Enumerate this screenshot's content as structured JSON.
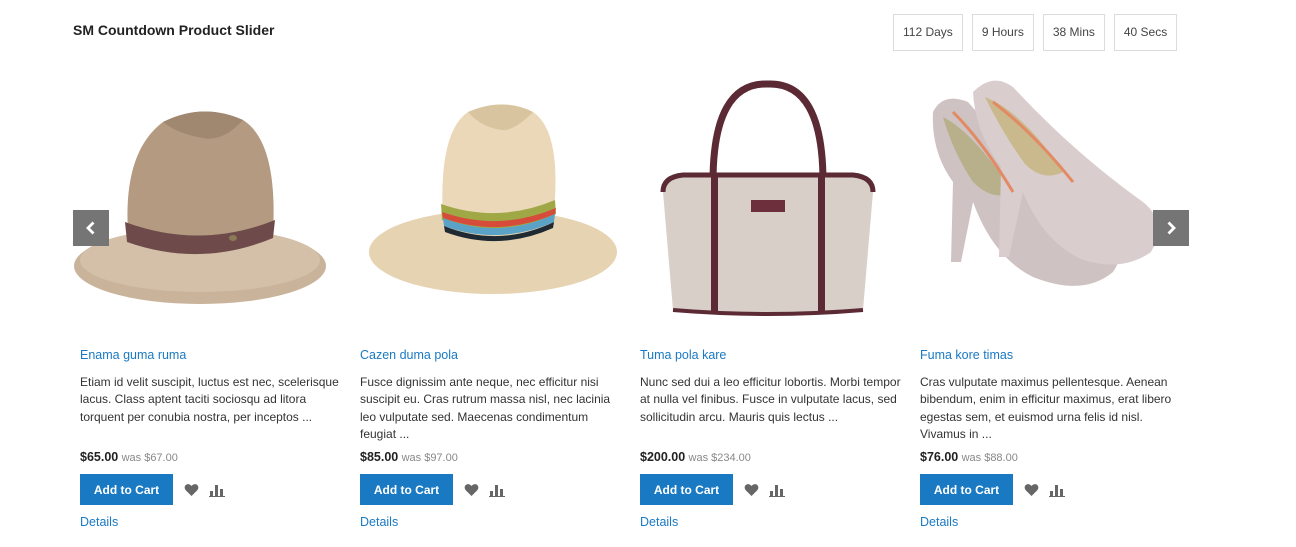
{
  "slider": {
    "title": "SM Countdown Product Slider",
    "countdown": [
      "112 Days",
      "9 Hours",
      "38 Mins",
      "40 Secs"
    ]
  },
  "products": [
    {
      "name": "Enama guma ruma",
      "description": "Etiam id velit suscipit, luctus est nec, scelerisque lacus. Class aptent taciti sociosqu ad litora torquent per conubia nostra, per inceptos ...",
      "price": "$65.00",
      "was": "was $67.00",
      "cart_label": "Add to Cart",
      "details_label": "Details"
    },
    {
      "name": "Cazen duma pola",
      "description": " Fusce dignissim ante neque, nec efficitur nisi suscipit eu. Cras rutrum massa nisl, nec lacinia leo vulputate sed. Maecenas condimentum feugiat ...",
      "price": "$85.00",
      "was": "was $97.00",
      "cart_label": "Add to Cart",
      "details_label": "Details"
    },
    {
      "name": "Tuma pola kare",
      "description": "Nunc sed dui a leo efficitur lobortis. Morbi tempor at nulla vel finibus. Fusce in vulputate lacus, sed sollicitudin arcu. Mauris quis lectus ...",
      "price": "$200.00",
      "was": "was $234.00",
      "cart_label": "Add to Cart",
      "details_label": "Details"
    },
    {
      "name": "Fuma kore timas",
      "description": "Cras vulputate maximus pellentesque. Aenean bibendum, enim in efficitur maximus, erat libero egestas sem, et euismod urna felis id nisl. Vivamus in ...",
      "price": "$76.00",
      "was": "was $88.00",
      "cart_label": "Add to Cart",
      "details_label": "Details"
    }
  ],
  "icons": {
    "prev": "chevron-left-icon",
    "next": "chevron-right-icon",
    "wishlist": "heart-icon",
    "compare": "bar-chart-icon"
  },
  "colors": {
    "link": "#1979c3",
    "button": "#1979c3",
    "nav": "#757575"
  }
}
